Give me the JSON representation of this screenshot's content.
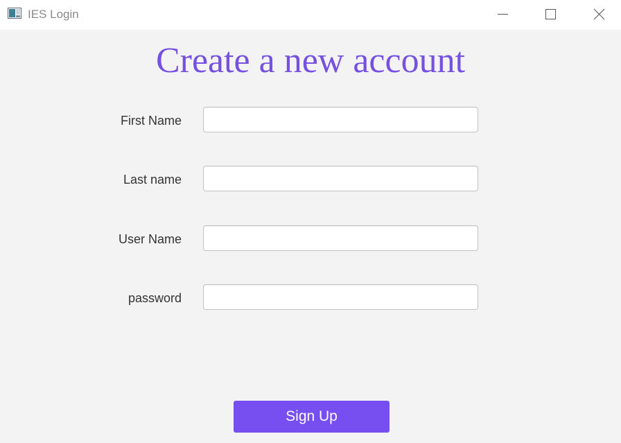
{
  "window": {
    "title": "IES Login",
    "controls": [
      "minimize-icon",
      "maximize-icon",
      "close-icon"
    ]
  },
  "form": {
    "heading": "Create a new account",
    "fields": [
      {
        "label": "First Name",
        "value": "",
        "placeholder": ""
      },
      {
        "label": "Last name",
        "value": "",
        "placeholder": ""
      },
      {
        "label": "User Name",
        "value": "",
        "placeholder": ""
      },
      {
        "label": "password",
        "value": "",
        "placeholder": ""
      }
    ],
    "submit_label": "Sign Up"
  },
  "colors": {
    "accent": "#774ff0",
    "heading": "#7650e0",
    "background": "#f3f3f3"
  }
}
